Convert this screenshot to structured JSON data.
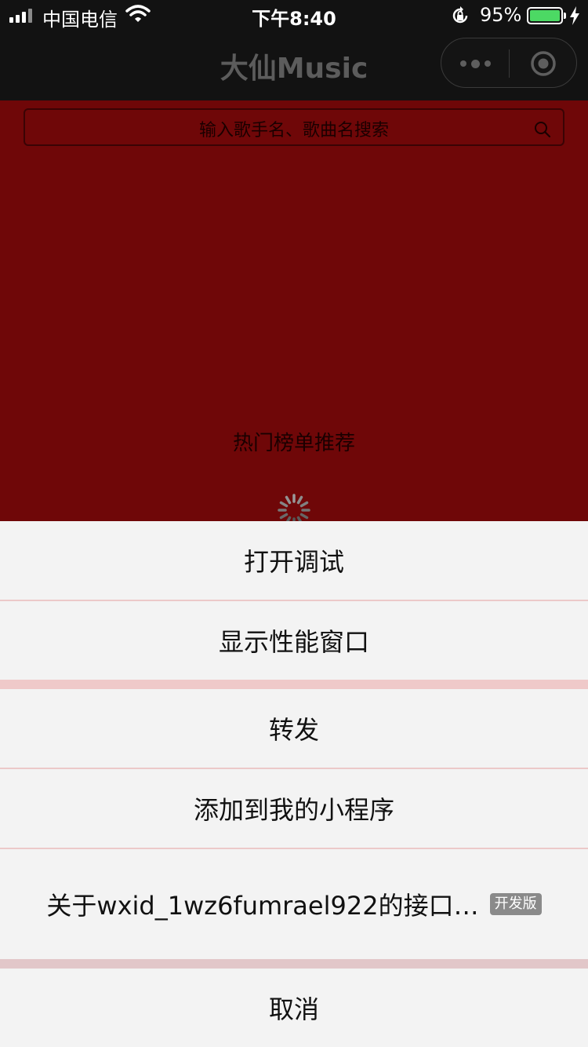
{
  "status_bar": {
    "carrier": "中国电信",
    "time": "下午8:40",
    "battery_percent": "95%",
    "battery_level": 0.95
  },
  "nav": {
    "title": "大仙Music"
  },
  "search": {
    "placeholder": "输入歌手名、歌曲名搜索"
  },
  "content": {
    "section_title": "热门榜单推荐"
  },
  "action_sheet": {
    "open_debug": "打开调试",
    "show_perf": "显示性能窗口",
    "forward": "转发",
    "add_to_my": "添加到我的小程序",
    "about": "关于wxid_1wz6fumrael922的接口…",
    "dev_badge": "开发版",
    "cancel": "取消"
  },
  "colors": {
    "page_bg": "#6f0708",
    "bar_bg": "#121212",
    "sheet_bg": "#f3f3f3",
    "separator": "#ecc9c9",
    "battery_fill": "#4cd964"
  }
}
